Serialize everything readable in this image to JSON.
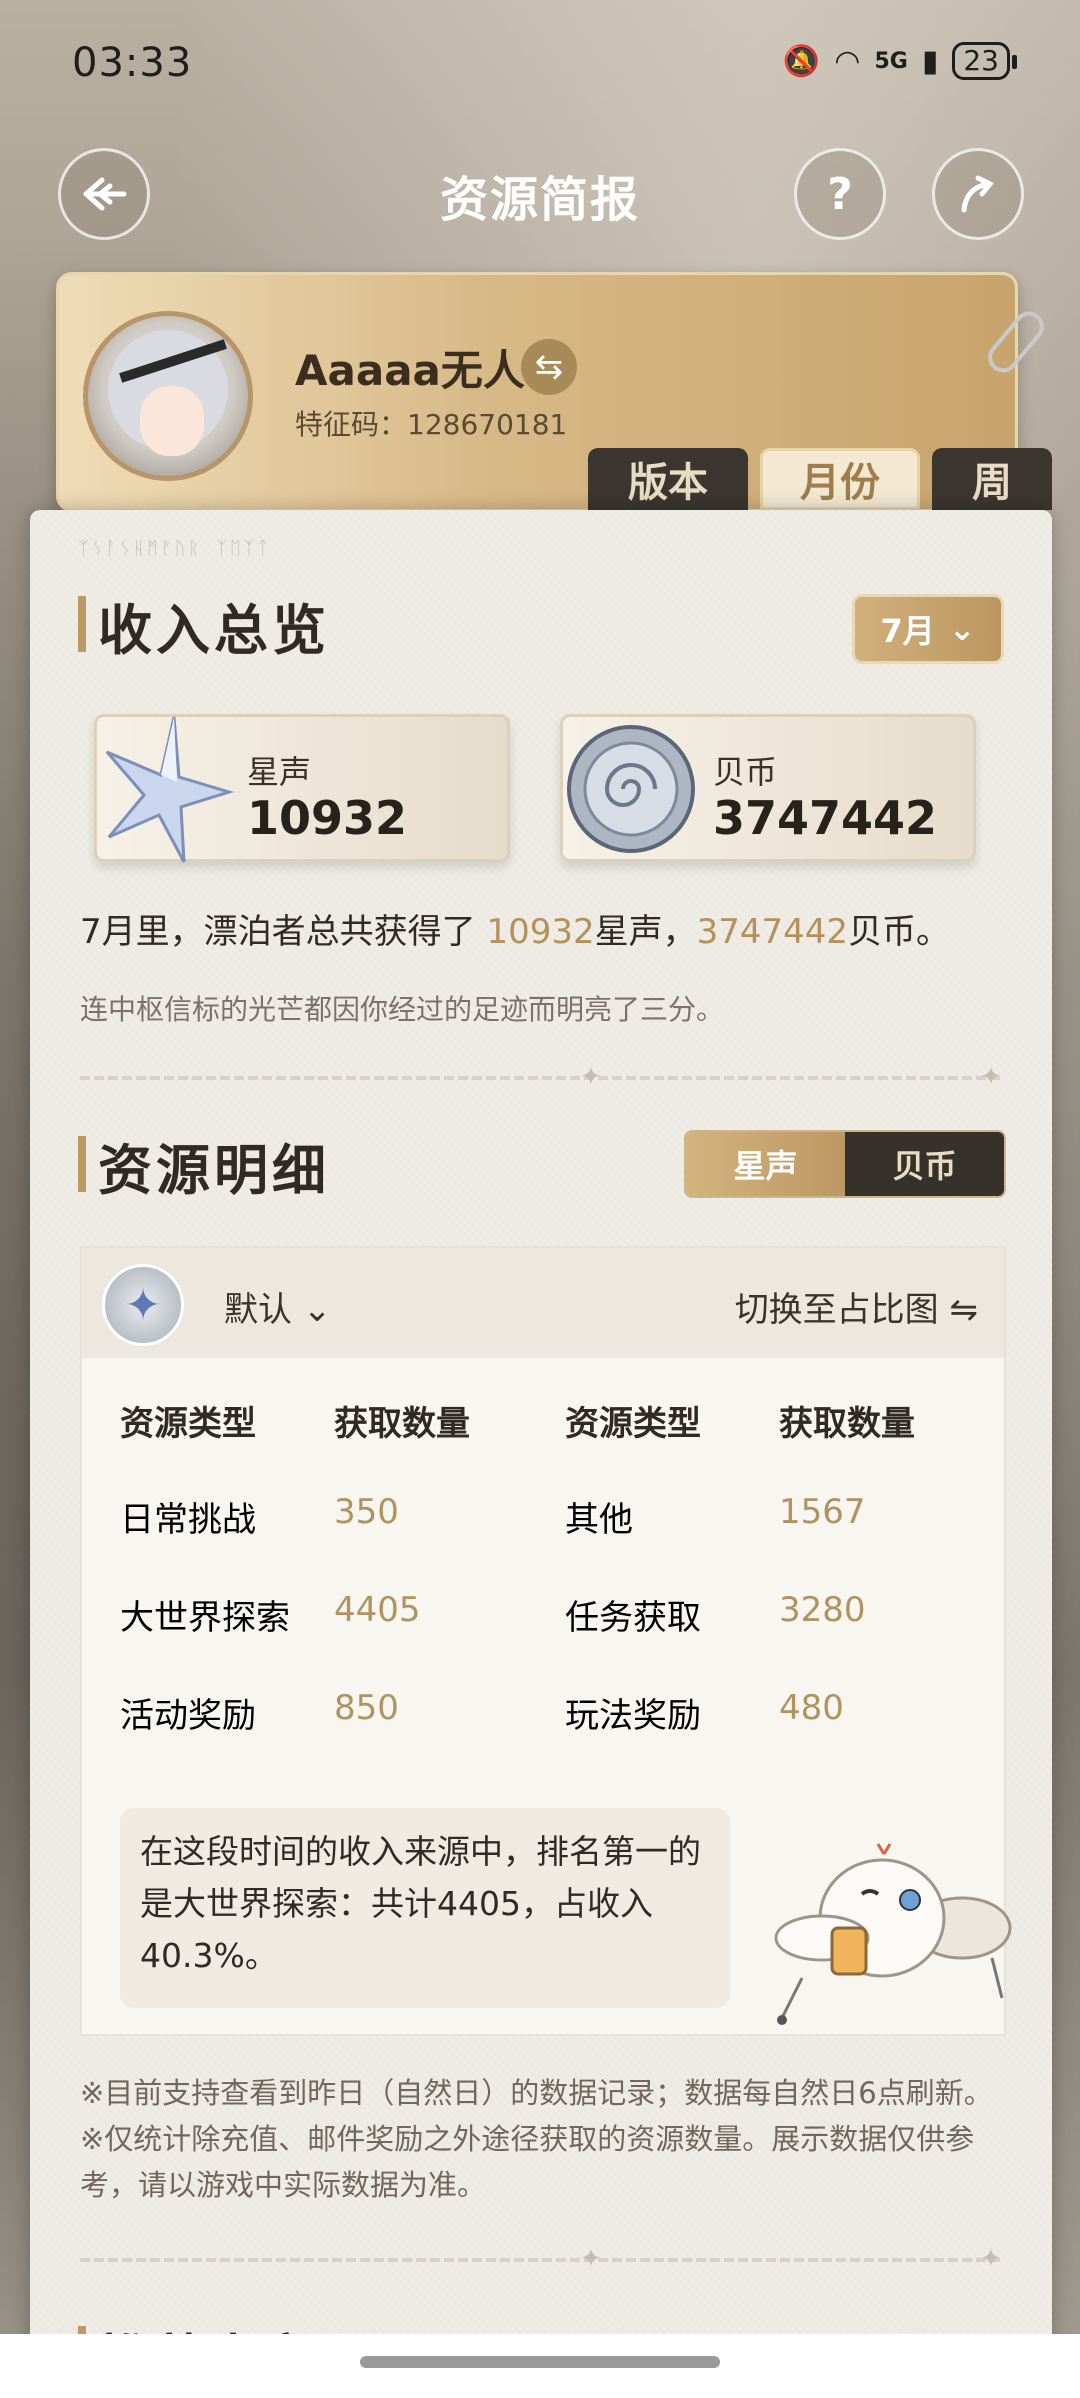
{
  "status_bar": {
    "time": "03:33",
    "network": "5G",
    "battery": "23"
  },
  "header": {
    "title": "资源简报",
    "help": "?"
  },
  "profile": {
    "name": "Aaaaa无人",
    "uid": "特征码：128670181",
    "swap_icon": "⇆"
  },
  "tabs": [
    {
      "label": "版本"
    },
    {
      "label": "月份"
    },
    {
      "label": "周"
    }
  ],
  "income": {
    "title": "收入总览",
    "month": "7月",
    "star": {
      "label": "星声",
      "value": "10932"
    },
    "coin": {
      "label": "贝币",
      "value": "3747442"
    },
    "summary": {
      "prefix": "7月里，漂泊者总共获得了 ",
      "star_value": "10932",
      "star_unit": "星声，",
      "coin_value": "3747442",
      "coin_unit": "贝币。"
    },
    "flavor": "连中枢信标的光芒都因你经过的足迹而明亮了三分。"
  },
  "detail": {
    "title": "资源明细",
    "toggle": {
      "on": "星声",
      "off": "贝币"
    },
    "filter": "默认",
    "switch_label": "切换至占比图",
    "headers": [
      "资源类型",
      "获取数量",
      "资源类型",
      "获取数量"
    ],
    "rows": [
      [
        "日常挑战",
        "350",
        "其他",
        "1567"
      ],
      [
        "大世界探索",
        "4405",
        "任务获取",
        "3280"
      ],
      [
        "活动奖励",
        "850",
        "玩法奖励",
        "480"
      ]
    ],
    "note_lines": [
      "在这段时间的收入来源中，排名第一的",
      "是大世界探索：共计4405，占收入",
      "40.3%。"
    ]
  },
  "footnotes": [
    "※目前支持查看到昨日（自然日）的数据记录；数据每自然日6点刷新。",
    "※仅统计除充值、邮件奖励之外途径获取的资源数量。展示数据仅供参",
    "考，请以游戏中实际数据为准。"
  ],
  "next_section": "推荐内容"
}
